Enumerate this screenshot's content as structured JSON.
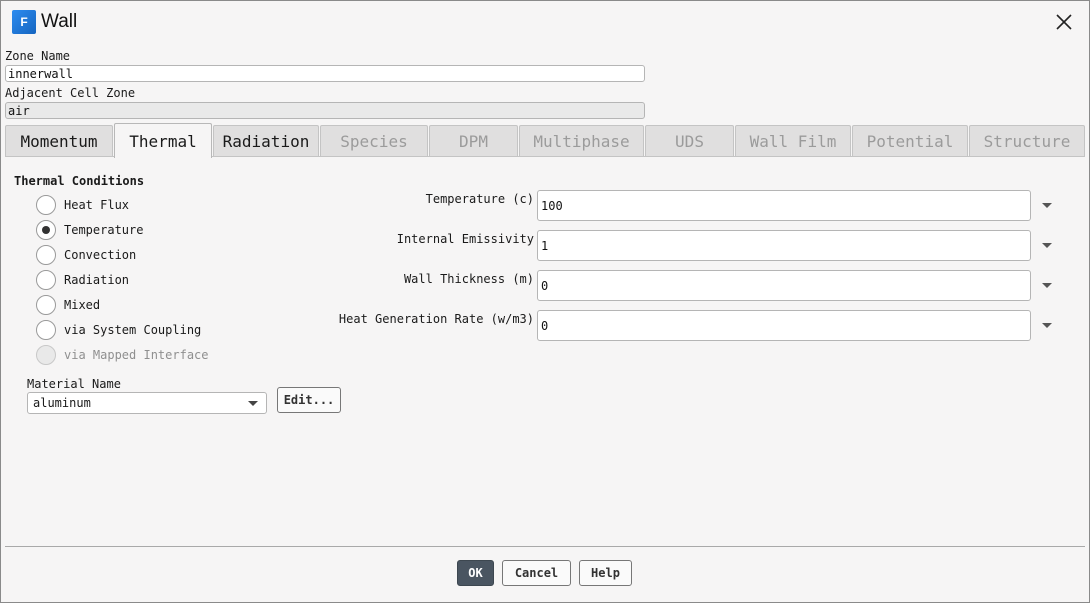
{
  "window": {
    "title": "Wall",
    "app_icon": "fluent-app-icon",
    "app_icon_letter": "F",
    "close_icon": "close-icon"
  },
  "zone": {
    "name_label": "Zone Name",
    "name_value": "innerwall",
    "adjacent_label": "Adjacent Cell Zone",
    "adjacent_value": "air"
  },
  "tabs": [
    {
      "label": "Momentum",
      "enabled": true,
      "active": false
    },
    {
      "label": "Thermal",
      "enabled": true,
      "active": true
    },
    {
      "label": "Radiation",
      "enabled": true,
      "active": false
    },
    {
      "label": "Species",
      "enabled": false,
      "active": false
    },
    {
      "label": "DPM",
      "enabled": false,
      "active": false
    },
    {
      "label": "Multiphase",
      "enabled": false,
      "active": false
    },
    {
      "label": "UDS",
      "enabled": false,
      "active": false
    },
    {
      "label": "Wall Film",
      "enabled": false,
      "active": false
    },
    {
      "label": "Potential",
      "enabled": false,
      "active": false
    },
    {
      "label": "Structure",
      "enabled": false,
      "active": false
    }
  ],
  "thermal": {
    "section_title": "Thermal Conditions",
    "options": [
      {
        "label": "Heat Flux",
        "checked": false,
        "disabled": false
      },
      {
        "label": "Temperature",
        "checked": true,
        "disabled": false
      },
      {
        "label": "Convection",
        "checked": false,
        "disabled": false
      },
      {
        "label": "Radiation",
        "checked": false,
        "disabled": false
      },
      {
        "label": "Mixed",
        "checked": false,
        "disabled": false
      },
      {
        "label": "via System Coupling",
        "checked": false,
        "disabled": false
      },
      {
        "label": "via Mapped Interface",
        "checked": false,
        "disabled": true
      }
    ],
    "material_label": "Material Name",
    "material_value": "aluminum",
    "edit_label": "Edit..."
  },
  "properties": [
    {
      "label": "Temperature (c)",
      "value": "100"
    },
    {
      "label": "Internal Emissivity",
      "value": "1"
    },
    {
      "label": "Wall Thickness (m)",
      "value": "0"
    },
    {
      "label": "Heat Generation Rate (w/m3)",
      "value": "0"
    }
  ],
  "buttons": {
    "ok": "OK",
    "cancel": "Cancel",
    "help": "Help"
  },
  "colors": {
    "primary_button": "#4a5561",
    "background": "#f6f5f5",
    "app_icon": "#1e74d6"
  }
}
